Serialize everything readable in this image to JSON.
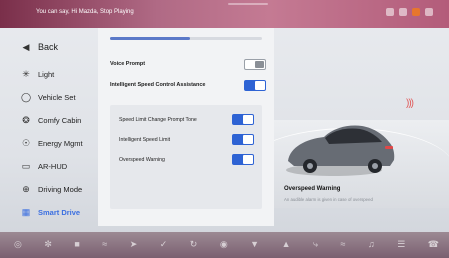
{
  "topbar": {
    "notice": "You can say, Hi Mazda, Stop Playing"
  },
  "sidebar": {
    "back_label": "Back",
    "items": [
      {
        "label": "Light",
        "icon": "light-icon"
      },
      {
        "label": "Vehicle Set",
        "icon": "vehicle-icon"
      },
      {
        "label": "Comfy Cabin",
        "icon": "cabin-icon"
      },
      {
        "label": "Energy Mgmt",
        "icon": "energy-icon"
      },
      {
        "label": "AR-HUD",
        "icon": "hud-icon"
      },
      {
        "label": "Driving Mode",
        "icon": "steering-wheel-icon"
      },
      {
        "label": "Smart Drive",
        "icon": "smart-drive-icon",
        "active": true
      }
    ]
  },
  "panel": {
    "voice_prompt": {
      "label": "Voice Prompt",
      "on": false
    },
    "isca": {
      "label": "Intelligent Speed Control Assistance",
      "on": true
    },
    "sub": [
      {
        "label": "Speed Limit Change Prompt Tone",
        "on": true
      },
      {
        "label": "Intelligent Speed Limit",
        "on": true
      },
      {
        "label": "Overspeed Warning",
        "on": true
      }
    ]
  },
  "preview": {
    "title": "Overspeed Warning",
    "description": "An audible alarm is given in case of overspeed"
  },
  "colors": {
    "accent": "#2e63d4",
    "active_text": "#3b6fe0"
  }
}
